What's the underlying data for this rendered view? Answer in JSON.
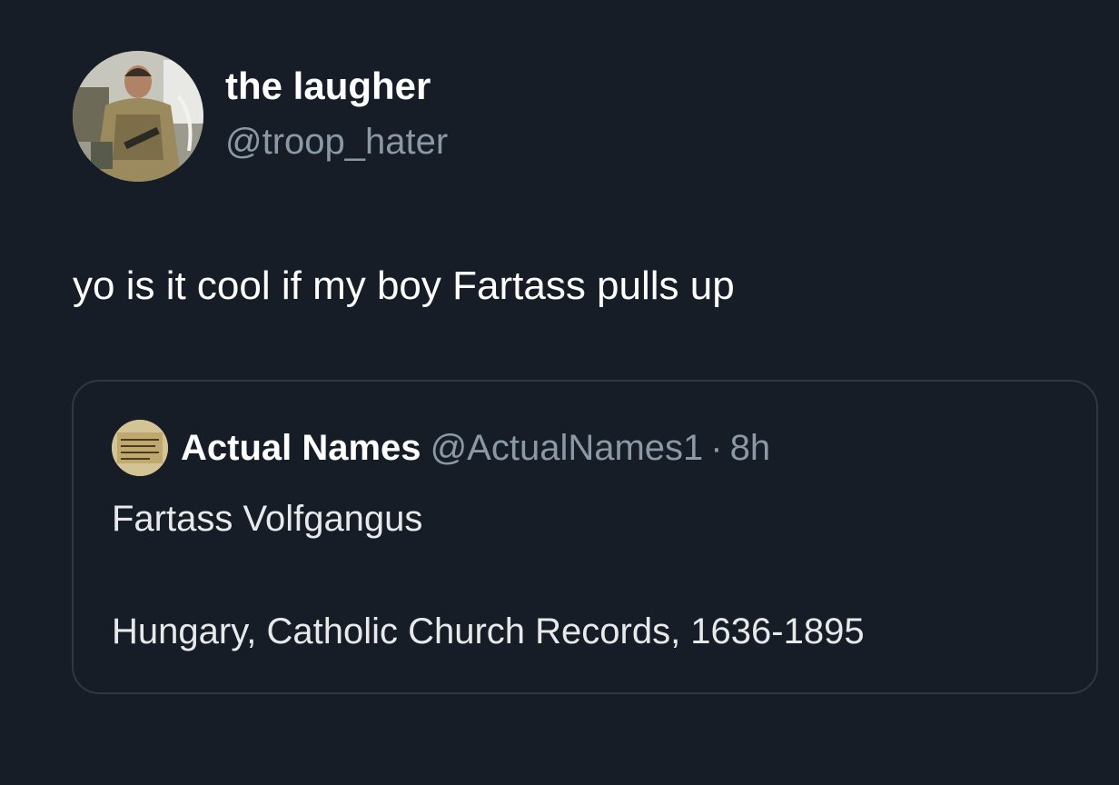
{
  "tweet": {
    "author": {
      "name": "the laugher",
      "handle": "@troop_hater",
      "avatar_icon": "user-avatar-soldier-photo"
    },
    "text": "yo is it cool if my boy Fartass pulls up",
    "quoted_tweet": {
      "author_name": "Actual Names",
      "author_handle": "@ActualNames1",
      "separator": "·",
      "time": "8h",
      "avatar_icon": "old-document-avatar",
      "lines": [
        "Fartass Volfgangus",
        "Hungary, Catholic Church Records, 1636-1895"
      ]
    }
  },
  "colors": {
    "background": "#161d27",
    "primary_text": "#ffffff",
    "secondary_text": "#8b98a5",
    "card_border": "#2f3741"
  }
}
